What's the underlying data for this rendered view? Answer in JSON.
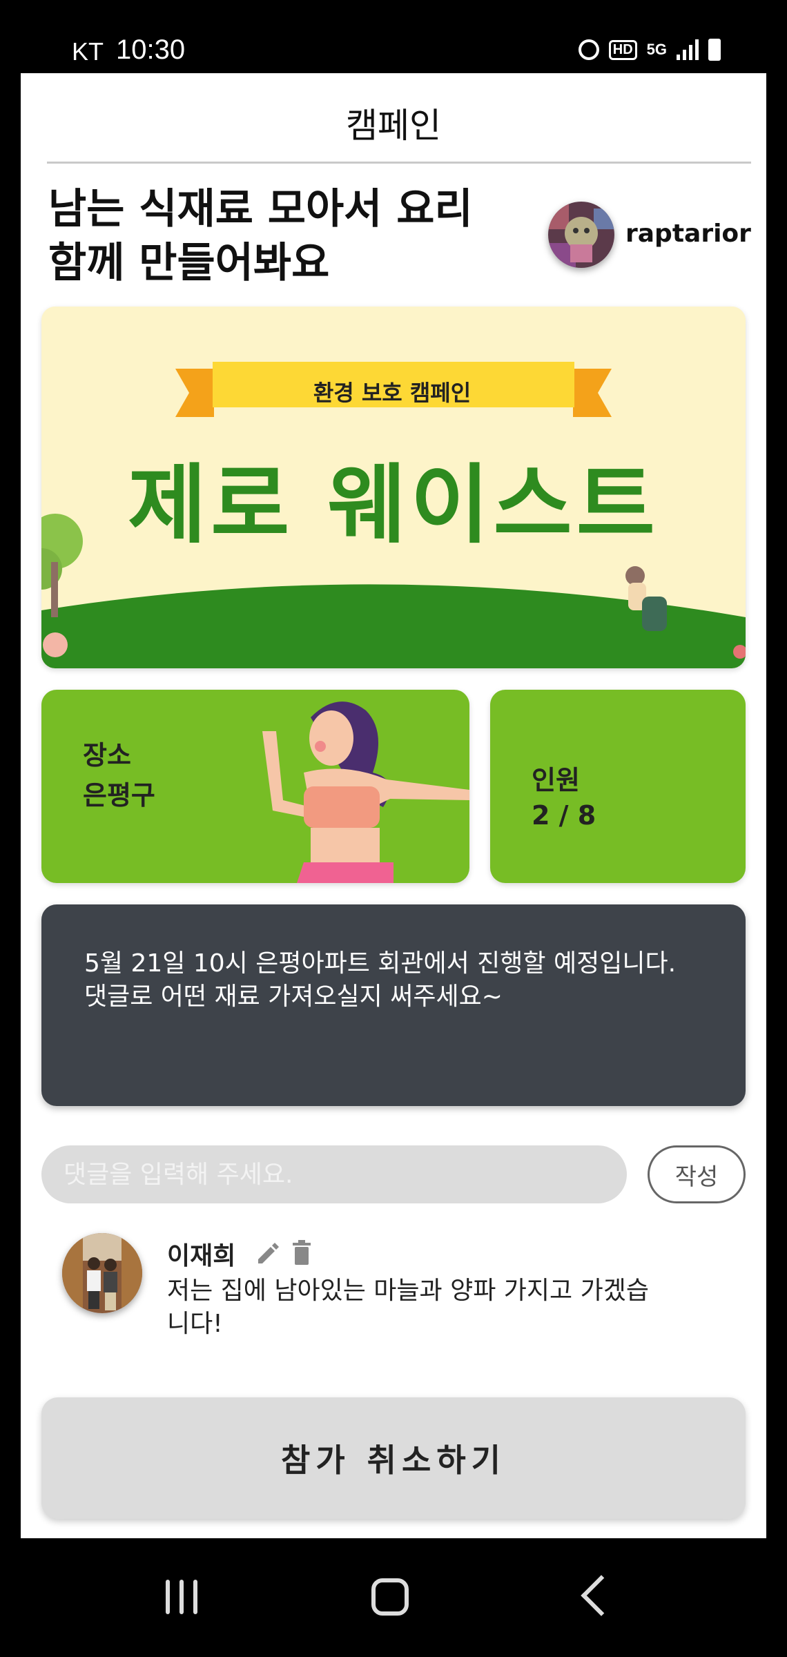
{
  "status_bar": {
    "carrier": "KT",
    "time": "10:30",
    "icons": [
      "alarm-icon",
      "hd-voice-icon",
      "5g-icon",
      "signal-icon",
      "battery-icon"
    ],
    "hd_label": "HD",
    "network_label": "5G"
  },
  "header": {
    "title": "캠페인"
  },
  "campaign": {
    "title": "남는 식재료 모아서 요리\n함께 만들어봐요",
    "author": "raptarior"
  },
  "banner": {
    "ribbon": "환경 보호 캠페인",
    "headline": "제로 웨이스트"
  },
  "info": {
    "place_label": "장소",
    "place_value": "은평구",
    "people_label": "인원",
    "people_value": "2 / 8"
  },
  "description": "5월 21일 10시 은평아파트 회관에서 진행할 예정입니다. 댓글로 어떤 재료 가져오실지 써주세요~",
  "comment_form": {
    "placeholder": "댓글을 입력해 주세요.",
    "submit_label": "작성"
  },
  "comments": [
    {
      "author": "이재희",
      "text": "저는 집에 남아있는 마늘과 양파 가지고 가겠습니다!"
    }
  ],
  "cancel_button": "참가 취소하기",
  "colors": {
    "banner_bg": "#fdf4c9",
    "headline": "#2e8b1f",
    "card_green": "#77bd25",
    "description_bg": "#3e434a",
    "button_gray": "#dcdcdc"
  }
}
